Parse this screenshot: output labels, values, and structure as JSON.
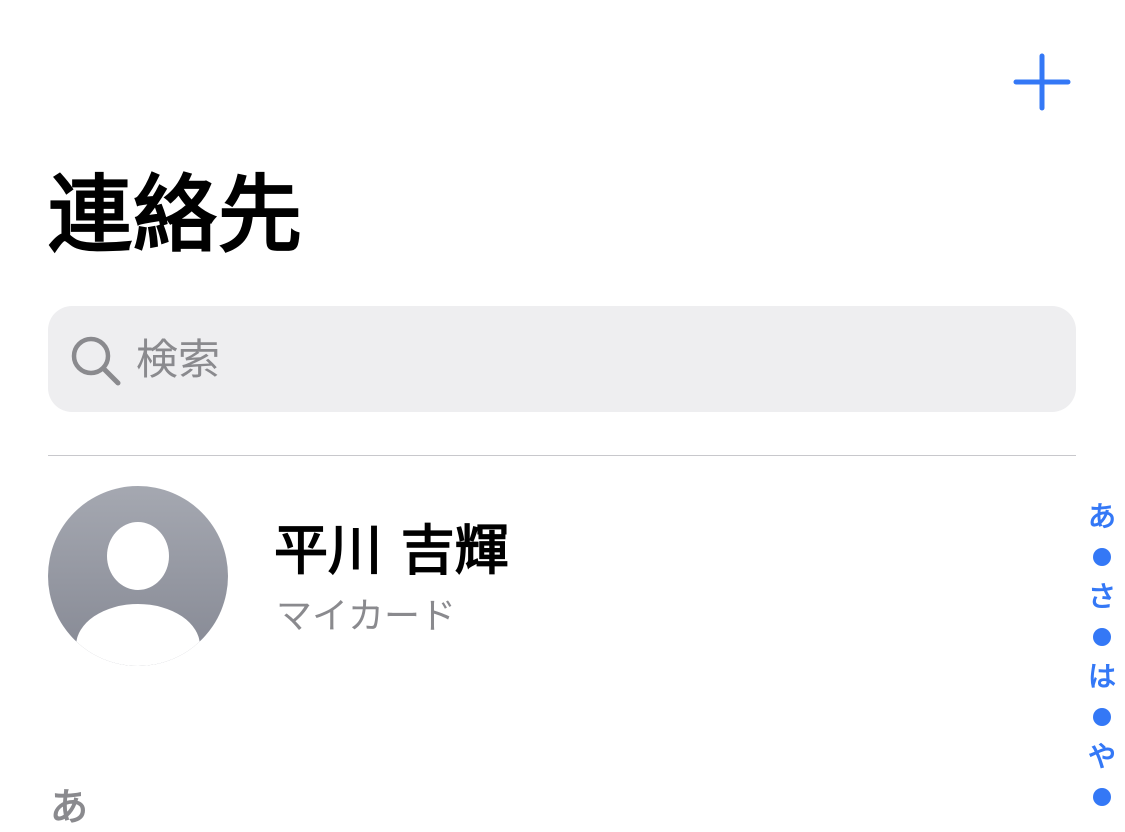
{
  "header": {
    "add_icon": "plus-icon",
    "accent_color": "#3478f6"
  },
  "title": "連絡先",
  "search": {
    "placeholder": "検索",
    "value": "",
    "icon": "search-icon"
  },
  "my_card": {
    "name": "平川 吉輝",
    "subtitle": "マイカード",
    "avatar_icon": "person-placeholder-icon"
  },
  "section": {
    "header": "あ"
  },
  "index": {
    "items": [
      "あ",
      "•",
      "さ",
      "•",
      "は",
      "•",
      "や",
      "•"
    ]
  }
}
